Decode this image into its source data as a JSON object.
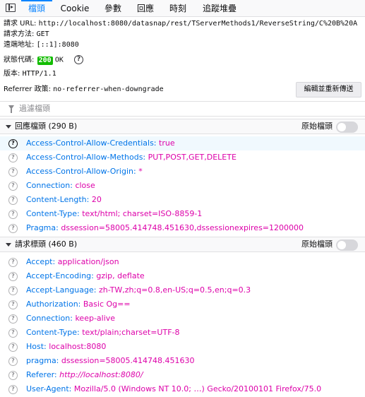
{
  "tabs": [
    {
      "label": "檔頭",
      "active": true
    },
    {
      "label": "Cookie",
      "active": false
    },
    {
      "label": "參數",
      "active": false
    },
    {
      "label": "回應",
      "active": false
    },
    {
      "label": "時刻",
      "active": false
    },
    {
      "label": "追蹤堆疊",
      "active": false
    }
  ],
  "summary": {
    "url_label": "請求 URL:",
    "url_value": "http://localhost:8080/datasnap/rest/TServerMethods1/ReverseString/C%20B%20A",
    "method_label": "請求方法:",
    "method_value": "GET",
    "remote_label": "遠端地址:",
    "remote_value": "[::1]:8080",
    "status_label": "狀態代碼:",
    "status_code": "200",
    "status_text": "OK",
    "version_label": "版本:",
    "version_value": "HTTP/1.1",
    "referrer_label": "Referrer 政策:",
    "referrer_value": "no-referrer-when-downgrade",
    "resend_button": "編輯並重新傳送"
  },
  "filter": {
    "placeholder": "過濾檔頭"
  },
  "response_headers": {
    "title": "回應檔頭 (290 B)",
    "raw_label": "原始檔頭",
    "rows": [
      {
        "name": "Access-Control-Allow-Credentials:",
        "value": "true"
      },
      {
        "name": "Access-Control-Allow-Methods:",
        "value": "PUT,POST,GET,DELETE"
      },
      {
        "name": "Access-Control-Allow-Origin:",
        "value": "*"
      },
      {
        "name": "Connection:",
        "value": "close"
      },
      {
        "name": "Content-Length:",
        "value": "20"
      },
      {
        "name": "Content-Type:",
        "value": "text/html; charset=ISO-8859-1"
      },
      {
        "name": "Pragma:",
        "value": "dssession=58005.414748.451630,dssessionexpires=1200000"
      }
    ]
  },
  "request_headers": {
    "title": "請求標頭 (460 B)",
    "raw_label": "原始檔頭",
    "rows": [
      {
        "name": "Accept:",
        "value": "application/json"
      },
      {
        "name": "Accept-Encoding:",
        "value": "gzip, deflate"
      },
      {
        "name": "Accept-Language:",
        "value": "zh-TW,zh;q=0.8,en-US;q=0.5,en;q=0.3"
      },
      {
        "name": "Authorization:",
        "value": "Basic Og=="
      },
      {
        "name": "Connection:",
        "value": "keep-alive"
      },
      {
        "name": "Content-Type:",
        "value": "text/plain;charset=UTF-8"
      },
      {
        "name": "Host:",
        "value": "localhost:8080"
      },
      {
        "name": "pragma:",
        "value": "dssession=58005.414748.451630"
      },
      {
        "name": "Referer:",
        "value": "http://localhost:8080/"
      },
      {
        "name": "User-Agent:",
        "value": "Mozilla/5.0 (Windows NT 10.0; …) Gecko/20100101 Firefox/75.0"
      }
    ]
  },
  "colors": {
    "accent": "#0a84ff",
    "header_name": "#0074e8",
    "header_value": "#dd00a9",
    "status_ok": "#12bc00"
  }
}
